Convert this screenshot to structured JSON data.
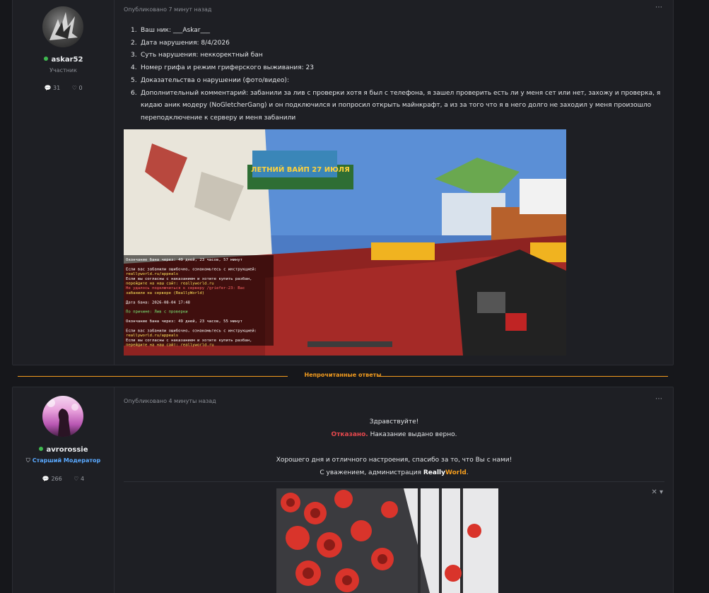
{
  "posts": [
    {
      "author": {
        "name": "askar52",
        "role": "Участник",
        "comments": "31",
        "likes": "0",
        "online": true
      },
      "timestamp": "Опубликовано 7 минут назад",
      "items": [
        {
          "n": "1.",
          "text": "Ваш ник: ___Askar___"
        },
        {
          "n": "2.",
          "text": "Дата нарушения: 8/4/2026"
        },
        {
          "n": "3.",
          "text": "Суть нарушения: неккоректный бан"
        },
        {
          "n": "4.",
          "text": "Номер грифа и режим гриферского выживания: 23"
        },
        {
          "n": "5.",
          "text": "Доказательства о нарушении (фото/видео):"
        },
        {
          "n": "6.",
          "text": "Дополнительный комментарий: забанили за лив с проверки хотя я был с телефона, я зашел проверить есть ли у меня сет или нет, захожу и проверка, я кидаю аник модеру (NoGletcherGang) и он подключился и попросил открыть майнкрафт, а из за того что я в него долго не заходил у меня произошло переподключение к серверу и меня забанили"
        }
      ],
      "screenshot": {
        "banner": "ЛЕТНИЙ ВАЙП 27 ИЮЛЯ",
        "chat": [
          {
            "text": "Окончание бана через: 49 дней, 23 часов, 57 минут",
            "color": "#ffffff"
          },
          {
            "text": "",
            "color": "#ffffff"
          },
          {
            "text": "Если вас забанили ошибочно, ознакомьтесь с инструкцией:",
            "color": "#ffffff"
          },
          {
            "text": "reallyworld.ru/appeals",
            "color": "#ffe45a"
          },
          {
            "text": "Если вы согласны с наказанием и хотите купить разбан,",
            "color": "#ffffff"
          },
          {
            "text": "перейдите на наш сайт: reallyworld.ru",
            "color": "#ffe45a"
          },
          {
            "text": "Не удалось подключиться к серверу /griefer-23: Вас",
            "color": "#ff6666"
          },
          {
            "text": "забанили на сервере (ReallyWorld)",
            "color": "#ffe45a"
          },
          {
            "text": "",
            "color": "#ffffff"
          },
          {
            "text": "Дата бана: 2026-08-04 17:48",
            "color": "#ffffff"
          },
          {
            "text": "",
            "color": "#ffffff"
          },
          {
            "text": "По причине: Лив с проверки",
            "color": "#7cf57c"
          },
          {
            "text": "",
            "color": "#ffffff"
          },
          {
            "text": "Окончание бана через: 49 дней, 23 часов, 55 минут",
            "color": "#ffffff"
          },
          {
            "text": "",
            "color": "#ffffff"
          },
          {
            "text": "Если вас забанили ошибочно, ознакомьтесь с инструкцией:",
            "color": "#ffffff"
          },
          {
            "text": "reallyworld.ru/appeals",
            "color": "#ffe45a"
          },
          {
            "text": "Если вы согласны с наказанием и хотите купить разбан,",
            "color": "#ffffff"
          },
          {
            "text": "перейдите на наш сайт: reallyworld.ru",
            "color": "#ffe45a"
          }
        ]
      }
    },
    {
      "author": {
        "name": "avrorossie",
        "role": "Старший Модератор",
        "comments": "266",
        "likes": "4",
        "online": true
      },
      "timestamp": "Опубликовано 4 минуты назад",
      "reply": {
        "greeting": "Здравствуйте!",
        "verdict": "Отказано.",
        "verdict_rest": " Наказание выдано верно.",
        "closing": "Хорошего дня и отличного настроения, спасибо за то, что Вы с нами!",
        "signoff_prefix": "С уважением, администрация ",
        "brand_a": "Really",
        "brand_b": "World",
        "signoff_suffix": "."
      },
      "signature_controls": "✕ ▾"
    }
  ],
  "divider_label": "Непрочитанные ответы",
  "icons": {
    "more": "⋯",
    "comment": "comment-icon",
    "heart": "heart-icon",
    "shield": "shield-icon"
  },
  "colors": {
    "accent": "#f39c1e",
    "online": "#3fb950",
    "moderator": "#5aa9ff",
    "denied": "#e5484d"
  }
}
